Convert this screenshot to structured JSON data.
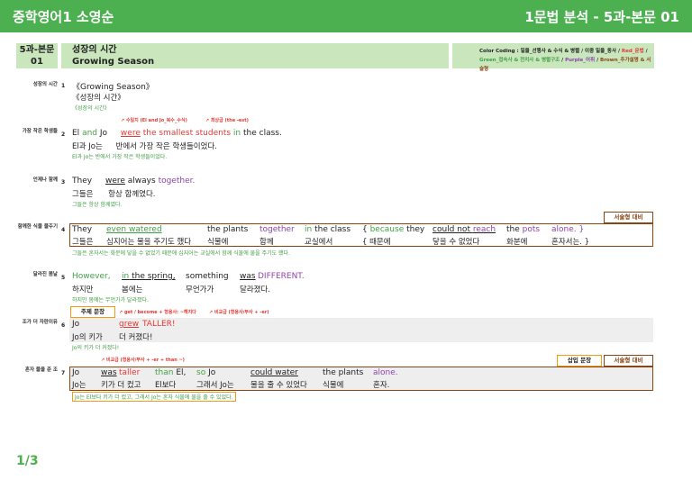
{
  "header": {
    "left_title": "중학영어1 소영순",
    "right_title": "1문법 분석 - 5과-본문 01"
  },
  "band": {
    "num_line1": "5과-본문",
    "num_line2": "01",
    "title_kr": "성장의 시간",
    "title_en": "Growing Season",
    "legend_1": "Color Coding : 일율_선행사 & 수식 & 병렬 / 이중 일율_동사 / ",
    "legend_1_red": "Red_문법",
    "legend_1_end": " /",
    "legend_2_green": "Green_접속사 & 전치사 & 병렬구조",
    "legend_2_sep1": " / ",
    "legend_2_purple": "Purple_어휘",
    "legend_2_sep2": " / ",
    "legend_2_brown": "Brown_추가설명 & 서술형"
  },
  "rows": {
    "r1": {
      "side": "성장의 시간",
      "num": "1",
      "en": "《Growing Season》",
      "kr": "《성장의 시간》",
      "small": "《성장의 시간》"
    },
    "r2": {
      "side": "가장 작은 학생들",
      "num": "2",
      "ann1": "수일치 (El and Jo_복수_수식)",
      "ann2": "최상급 (the -est)",
      "en_1": "El",
      "en_and": "and",
      "en_2": "Jo",
      "en_were": "were",
      "en_phrase": "the smallest students",
      "en_in": "in",
      "en_end": "the class.",
      "kr_1": "El과 Jo는",
      "kr_2": "반에서 가장 작은 학생들이었다.",
      "small": "El과 Jo는 반에서 가장 작은 학생들이었다."
    },
    "r3": {
      "side": "언제나 함께",
      "num": "3",
      "en_1": "They",
      "en_were": "were",
      "en_always": "always",
      "en_together": "together.",
      "kr_1": "그들은",
      "kr_2": "항상 함께였다.",
      "small": "그들은 항상 함께였다."
    },
    "r4": {
      "side": "함께한 식물 물주기",
      "num": "4",
      "tag": "서술형 대비",
      "en": [
        "They",
        "even watered",
        "the plants",
        "together",
        "in the class",
        "{ because they",
        "could not reach",
        "the pots",
        "alone. }"
      ],
      "kr": [
        "그들은",
        "심지어는 물을 주기도 했다",
        "식물에",
        "함께",
        "교실에서",
        "{ 때문에",
        "닿을 수 없었다",
        "화분에",
        "혼자서는. }"
      ],
      "small": "그들은 혼자서는 화분에 닿을 수 없었기 때문에 심지어는 교실에서 함께 식물에 물을 주기도 했다."
    },
    "r5": {
      "side": "달라진 봄날",
      "num": "5",
      "en": [
        "However,",
        "in the spring,",
        "something",
        "was",
        "DIFFERENT."
      ],
      "kr": [
        "하지만",
        "봄에는",
        "무언가가",
        "달라졌다."
      ],
      "small": "하지만 봄에는 무언가가 달라졌다."
    },
    "r6": {
      "side": "조가 더 자란이유",
      "num": "6",
      "tag": "주제 문장",
      "ann1": "get / become + 형용사: ~해지다",
      "ann2": "비교급 (형용사/부사 + -er)",
      "en_1": "Jo",
      "en_2": "grew",
      "en_3": "TALLER!",
      "kr_1": "Jo의 키가",
      "kr_2": "더 커졌다!",
      "small": "Jo의 키가 더 커졌다!"
    },
    "r7": {
      "side": "혼자 물을 준 조",
      "num": "7",
      "ann": "비교급 (형용사/부사 + -er + than ~)",
      "tag1": "삽입 문장",
      "tag2": "서술형 대비",
      "en": [
        "Jo",
        "was",
        "taller",
        "than El,",
        "so Jo",
        "could water",
        "the plants",
        "alone."
      ],
      "kr": [
        "Jo는",
        "키가 더 컸고",
        "El보다",
        "그래서 Jo는",
        "물을 줄 수 있었다",
        "식물에",
        "혼자."
      ],
      "small": "Jo는 El보다 키가 더 컸고, 그래서 Jo는 혼자 식물에 물을 줄 수 있었다."
    }
  },
  "footer": {
    "page": "1/3"
  },
  "colors": {
    "header_green": "#4caf50",
    "band_green": "#c9e6bd",
    "red": "#e53935",
    "green": "#43a047",
    "purple": "#8e44ad",
    "brown": "#8b4513",
    "orange": "#f39c12"
  }
}
